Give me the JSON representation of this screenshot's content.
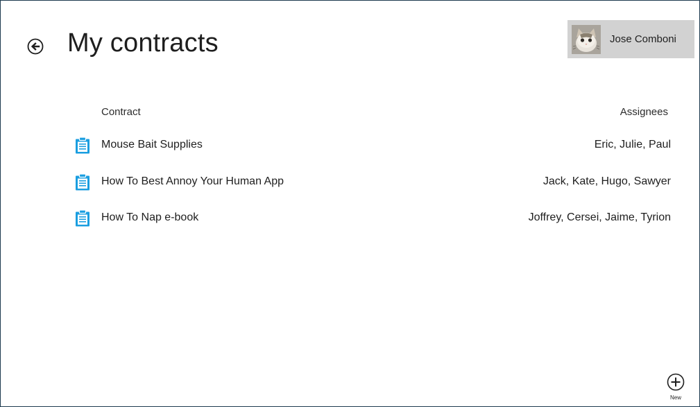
{
  "header": {
    "title": "My contracts",
    "back_icon": "back-arrow-circle-icon"
  },
  "user": {
    "name": "Jose Comboni",
    "avatar_icon": "kitten-avatar"
  },
  "table": {
    "columns": [
      "Contract",
      "Assignees"
    ],
    "row_icon": "clipboard-icon",
    "icon_color": "#1a9ee0",
    "rows": [
      {
        "name": "Mouse Bait Supplies",
        "assignees": "Eric, Julie, Paul"
      },
      {
        "name": "How To Best Annoy Your Human App",
        "assignees": "Jack, Kate, Hugo, Sawyer"
      },
      {
        "name": "How To Nap e-book",
        "assignees": "Joffrey, Cersei, Jaime, Tyrion"
      }
    ]
  },
  "appbar": {
    "new_label": "New",
    "new_icon": "plus-circle-icon"
  }
}
